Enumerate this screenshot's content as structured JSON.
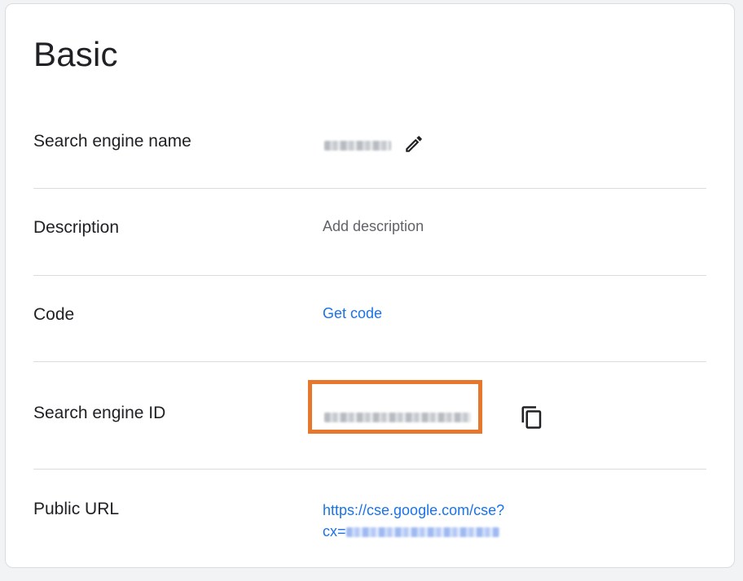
{
  "section": {
    "title": "Basic"
  },
  "rows": {
    "name": {
      "label": "Search engine name"
    },
    "description": {
      "label": "Description",
      "placeholder": "Add description"
    },
    "code": {
      "label": "Code",
      "link": "Get code"
    },
    "id": {
      "label": "Search engine ID"
    },
    "public_url": {
      "label": "Public URL",
      "url_line1": "https://cse.google.com/cse?",
      "url_prefix": "cx="
    }
  },
  "icons": {
    "edit": "pencil-icon",
    "copy": "copy-icon"
  },
  "colors": {
    "link": "#1a73e8",
    "highlight": "#e8772e",
    "text": "#202124",
    "muted": "#5f6368"
  }
}
